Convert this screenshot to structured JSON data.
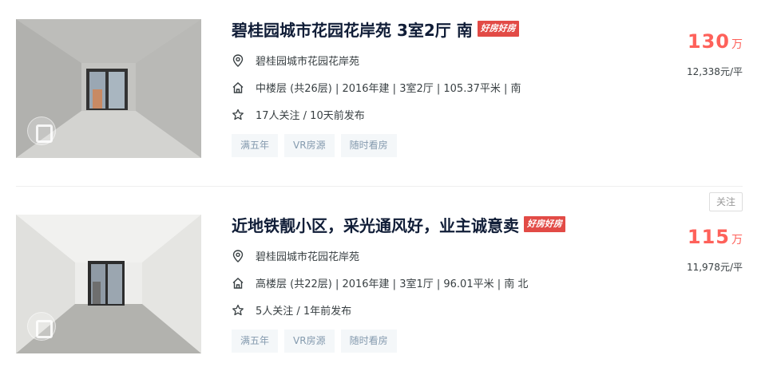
{
  "listings": [
    {
      "title": "碧桂园城市花园花岸苑 3室2厅 南",
      "badge": "好房好房",
      "community": "碧桂园城市花园花岸苑",
      "house_info": "中楼层 (共26层) | 2016年建 | 3室2厅 | 105.37平米 | 南",
      "follow_info": "17人关注 / 10天前发布",
      "tags": [
        "满五年",
        "VR房源",
        "随时看房"
      ],
      "total_price": "130",
      "price_unit": "万",
      "unit_price": "12,338元/平",
      "thumbnail_icon": "vr-icon"
    },
    {
      "title": "近地铁靓小区，采光通风好，业主诚意卖",
      "badge": "好房好房",
      "community": "碧桂园城市花园花岸苑",
      "house_info": "高楼层 (共22层) | 2016年建 | 3室1厅 | 96.01平米 | 南 北",
      "follow_info": "5人关注 / 1年前发布",
      "tags": [
        "满五年",
        "VR房源",
        "随时看房"
      ],
      "total_price": "115",
      "price_unit": "万",
      "unit_price": "11,978元/平",
      "follow_button": "关注",
      "thumbnail_icon": "vr-icon"
    }
  ],
  "colors": {
    "title": "#101d37",
    "price": "#fe615a",
    "badge": "#e24b46",
    "tag_bg": "#f4f7f9",
    "tag_text": "#849aae"
  }
}
